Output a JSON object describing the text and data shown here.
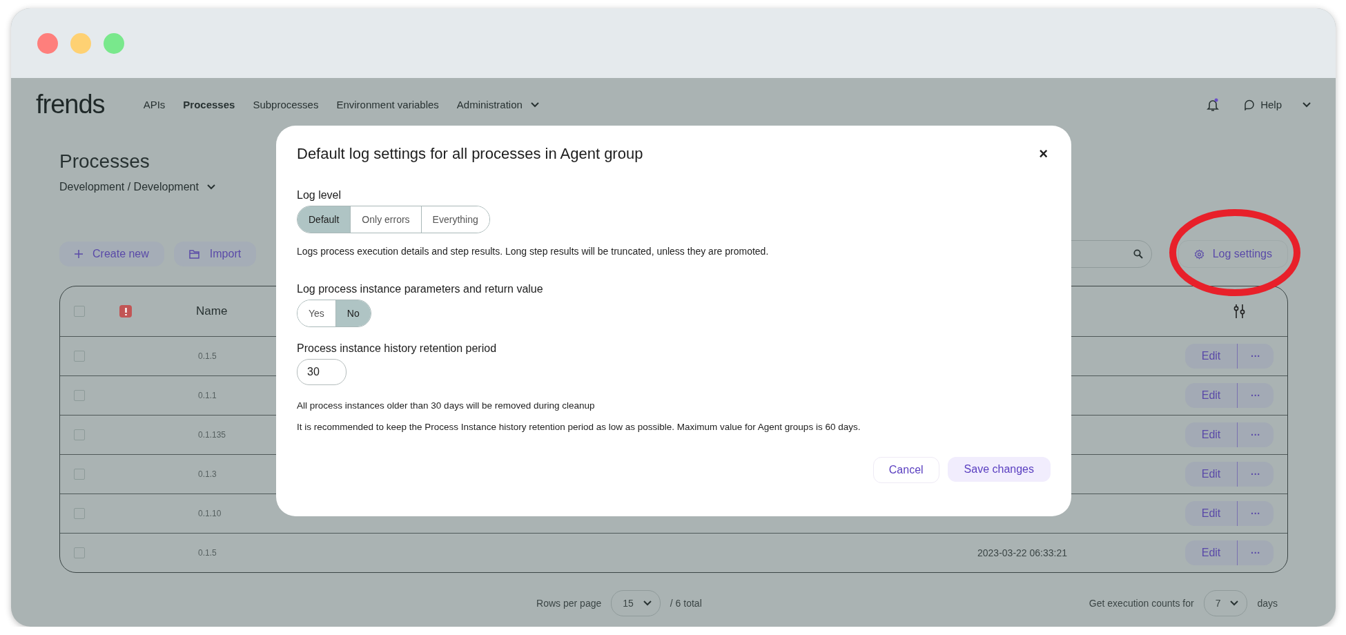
{
  "nav": {
    "logo": "frends",
    "links": [
      {
        "label": "APIs",
        "selected": false,
        "kind": "link"
      },
      {
        "label": "Processes",
        "selected": true,
        "kind": "link"
      },
      {
        "label": "Subprocesses",
        "selected": false,
        "kind": "link"
      },
      {
        "label": "Environment variables",
        "selected": false,
        "kind": "link"
      },
      {
        "label": "Administration",
        "selected": false,
        "kind": "dropdown"
      }
    ],
    "help": "Help"
  },
  "page": {
    "title": "Processes",
    "breadcrumb": "Development / Development",
    "actions": [
      {
        "label": "Create new",
        "kind": "create"
      },
      {
        "label": "Import",
        "kind": "import"
      }
    ],
    "log_settings": "Log settings"
  },
  "table": {
    "header": {
      "checked": false,
      "name": "Name"
    },
    "rows": [
      {
        "name": "0.1.5",
        "checked": false,
        "edit": "Edit",
        "more": "···"
      },
      {
        "name": "0.1.1",
        "checked": false,
        "edit": "Edit",
        "more": "···"
      },
      {
        "name": "0.1.135",
        "checked": false,
        "edit": "Edit",
        "more": "···"
      },
      {
        "name": "0.1.3",
        "checked": false,
        "edit": "Edit",
        "more": "···"
      },
      {
        "name": "0.1.10",
        "checked": false,
        "edit": "Edit",
        "more": "···"
      },
      {
        "name": "0.1.5",
        "checked": false,
        "date": "2023-03-22 06:33:21",
        "edit": "Edit",
        "more": "···"
      }
    ]
  },
  "footer": {
    "rows_label": "Rows per page",
    "rows_value": "15",
    "total": "/ 6 total",
    "counts_label": "Get execution counts for",
    "counts_value": "7",
    "counts_unit": "days"
  },
  "modal": {
    "title": "Default log settings for all processes in Agent group",
    "close": "×",
    "log_level": {
      "label": "Log level",
      "options": [
        {
          "label": "Default",
          "selected": true
        },
        {
          "label": "Only errors",
          "selected": false
        },
        {
          "label": "Everything",
          "selected": false
        }
      ],
      "description": "Logs process execution details and step results. Long step results will be truncated, unless they are promoted."
    },
    "log_params": {
      "label": "Log process instance parameters and return value",
      "options": [
        {
          "label": "Yes",
          "selected": false
        },
        {
          "label": "No",
          "selected": true
        }
      ]
    },
    "retention": {
      "label": "Process instance history retention period",
      "value": "30",
      "notes": [
        "All process instances older than 30 days will be removed during cleanup",
        "It is recommended to keep the Process Instance history retention period as low as possible. Maximum value for Agent groups is 60 days."
      ]
    },
    "cancel": "Cancel",
    "save": "Save changes"
  }
}
